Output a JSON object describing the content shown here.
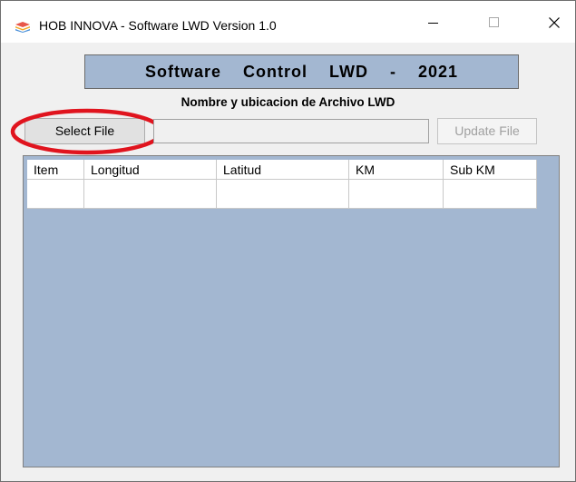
{
  "window": {
    "title": "HOB INNOVA - Software LWD Version 1.0",
    "app_icon": "stacked-layers-icon",
    "controls": [
      "minimize-icon",
      "maximize-icon",
      "close-icon"
    ]
  },
  "banner": {
    "text": "Software  Control  LWD  -  2021"
  },
  "file_section": {
    "label": "Nombre y ubicacion de Archivo LWD",
    "select_button": "Select File",
    "path_value": "",
    "update_button": "Update File"
  },
  "table": {
    "columns": [
      "Item",
      "Longitud",
      "Latitud",
      "KM",
      "Sub KM"
    ],
    "rows": [
      [
        "",
        "",
        "",
        "",
        ""
      ]
    ]
  },
  "colors": {
    "banner_bg": "#a3b7d1",
    "grid_bg": "#a3b7d1",
    "highlight_ring": "#e0141e",
    "window_bg": "#f0f0f0"
  }
}
